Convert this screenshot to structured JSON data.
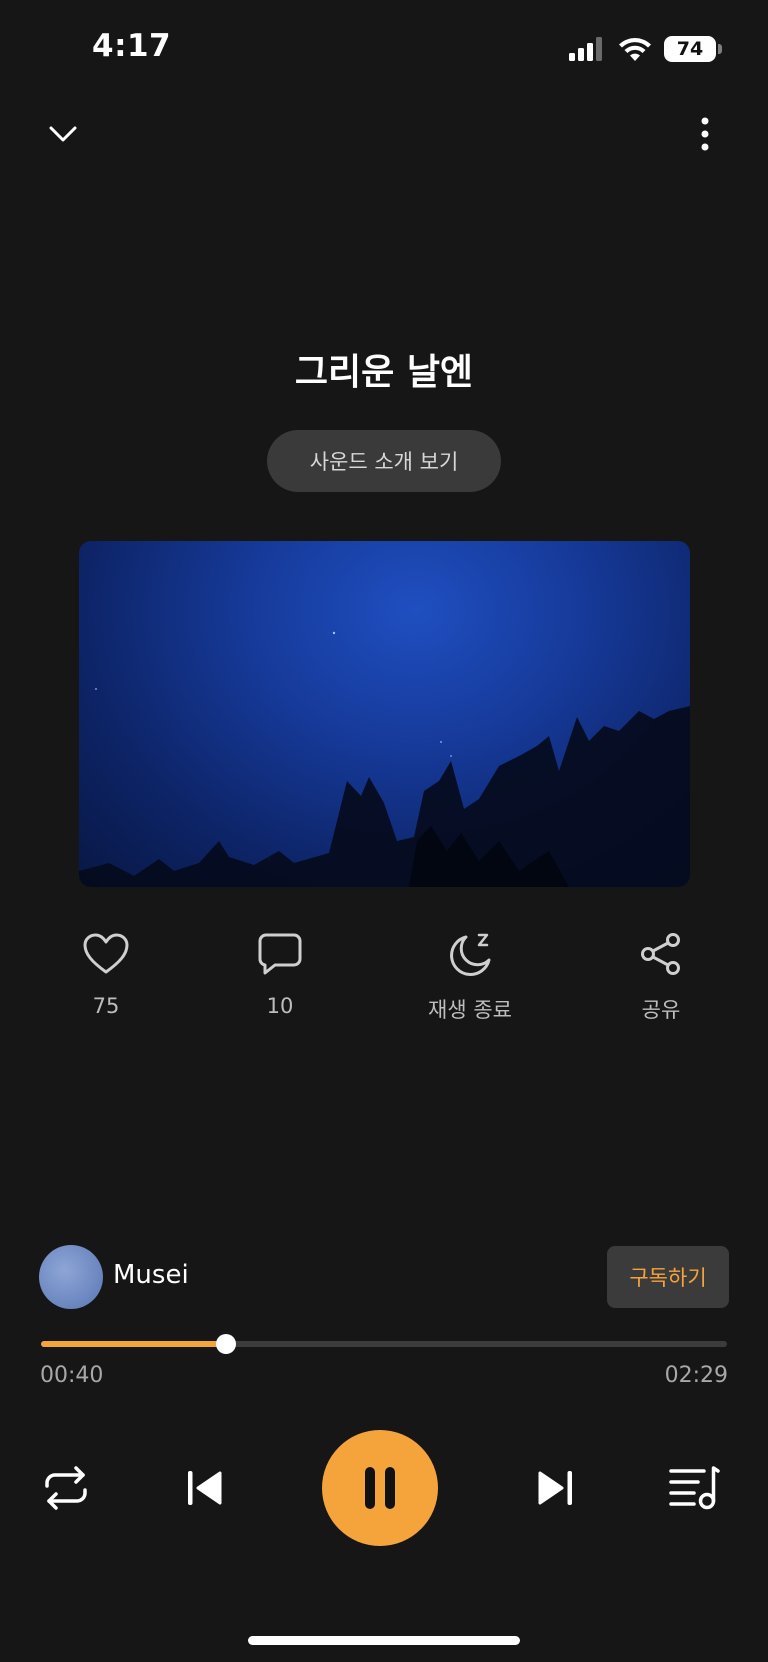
{
  "status_bar": {
    "time": "4:17",
    "battery": "74"
  },
  "track": {
    "title": "그리운 날엔",
    "intro_label": "사운드 소개 보기"
  },
  "actions": {
    "like_count": "75",
    "comment_count": "10",
    "sleep_timer_label": "재생 종료",
    "share_label": "공유"
  },
  "artist": {
    "name": "Musei",
    "subscribe_label": "구독하기"
  },
  "playback": {
    "elapsed": "00:40",
    "duration": "02:29",
    "progress_fraction": 0.27,
    "state": "playing"
  },
  "colors": {
    "accent": "#f5a43b",
    "background": "#161616"
  },
  "icons": {
    "collapse": "chevron-down-icon",
    "more": "more-vertical-icon",
    "like": "heart-icon",
    "comment": "comment-icon",
    "sleep": "moon-icon",
    "share": "share-icon",
    "repeat": "repeat-icon",
    "previous": "skip-previous-icon",
    "pause": "pause-icon",
    "next": "skip-next-icon",
    "playlist": "playlist-icon"
  }
}
